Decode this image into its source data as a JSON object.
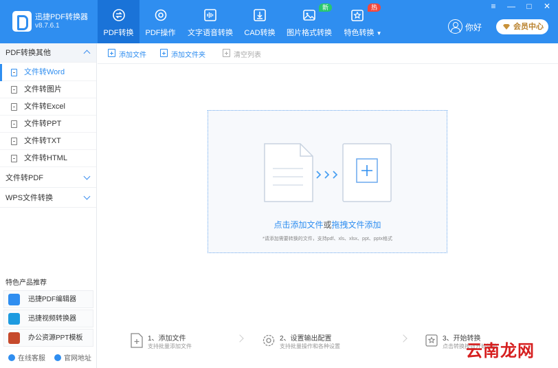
{
  "app": {
    "name": "迅捷PDF转换器",
    "version": "v8.7.6.1"
  },
  "tabs": [
    {
      "label": "PDF转换",
      "icon": "convert-icon",
      "active": true
    },
    {
      "label": "PDF操作",
      "icon": "gear-icon"
    },
    {
      "label": "文字语音转换",
      "icon": "audio-wave-icon"
    },
    {
      "label": "CAD转换",
      "icon": "cad-download-icon"
    },
    {
      "label": "图片格式转换",
      "icon": "image-icon",
      "badge": "新"
    },
    {
      "label": "特色转换",
      "icon": "star-box-icon",
      "badge": "热"
    }
  ],
  "window": {
    "menu": "≡",
    "minimize": "—",
    "maximize": "□",
    "close": "✕"
  },
  "user": {
    "name": "你好",
    "vip_label": "会员中心"
  },
  "sidebar": {
    "groups": [
      {
        "label": "PDF转换其他",
        "expanded": true,
        "items": [
          "文件转Word",
          "文件转图片",
          "文件转Excel",
          "文件转PPT",
          "文件转TXT",
          "文件转HTML"
        ]
      },
      {
        "label": "文件转PDF",
        "expanded": false
      },
      {
        "label": "WPS文件转换",
        "expanded": false
      }
    ],
    "featured_title": "特色产品推荐",
    "featured": [
      "迅捷PDF编辑器",
      "迅捷视频转换器",
      "办公资源PPT模板"
    ],
    "footer": [
      "在线客服",
      "官网地址"
    ]
  },
  "toolbar": {
    "add_file": "添加文件",
    "add_folder": "添加文件夹",
    "clear": "清空列表"
  },
  "dropzone": {
    "click_add": "点击添加文件",
    "or": "或",
    "drag_add": "拖拽文件添加",
    "hint": "*请添加需要转换的文件，支持pdf、xls、xlsx、ppt、pptx格式"
  },
  "steps": [
    {
      "title": "1、添加文件",
      "desc": "支持批量添加文件"
    },
    {
      "title": "2、设置输出配置",
      "desc": "支持批量操作和各种设置"
    },
    {
      "title": "3、开始转换",
      "desc": "点击转换按钮开始转换"
    }
  ],
  "watermark": "云南龙网",
  "colors": {
    "primary": "#2f8ef0",
    "active_tab": "#1a73d8",
    "badge_new": "#28c76f",
    "badge_hot": "#f4473b",
    "vip_text": "#b8802b"
  }
}
